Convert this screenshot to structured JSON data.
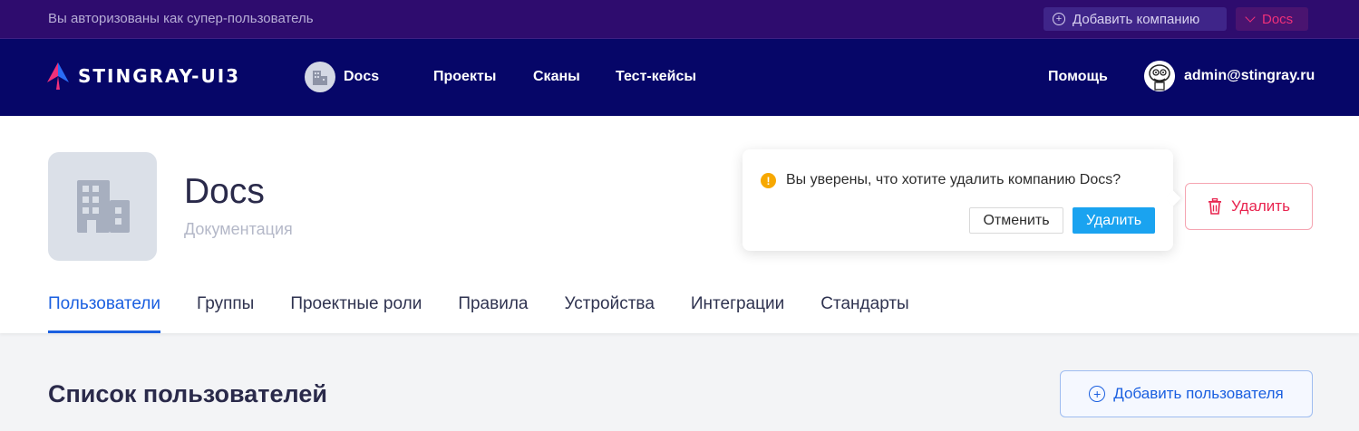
{
  "admin_bar": {
    "message": "Вы авторизованы как супер-пользователь",
    "add_company_label": "Добавить компанию",
    "company_select_label": "Docs"
  },
  "navbar": {
    "brand": "STINGRAY-UI3",
    "company_name": "Docs",
    "links": [
      {
        "label": "Проекты"
      },
      {
        "label": "Сканы"
      },
      {
        "label": "Тест-кейсы"
      }
    ],
    "help_label": "Помощь",
    "user_email": "admin@stingray.ru"
  },
  "company": {
    "name": "Docs",
    "description": "Документация",
    "delete_label": "Удалить"
  },
  "tabs": [
    {
      "label": "Пользователи",
      "active": true
    },
    {
      "label": "Группы",
      "active": false
    },
    {
      "label": "Проектные роли",
      "active": false
    },
    {
      "label": "Правила",
      "active": false
    },
    {
      "label": "Устройства",
      "active": false
    },
    {
      "label": "Интеграции",
      "active": false
    },
    {
      "label": "Стандарты",
      "active": false
    }
  ],
  "popconfirm": {
    "icon": "!",
    "message": "Вы уверены, что хотите удалить компанию Docs?",
    "cancel_label": "Отменить",
    "ok_label": "Удалить"
  },
  "users_section": {
    "title": "Список пользователей",
    "add_user_label": "Добавить пользователя"
  },
  "colors": {
    "admin_bar_bg": "#2e0c6e",
    "navbar_bg": "#060668",
    "accent_blue": "#1a5fe0",
    "danger": "#e8244f",
    "primary_button": "#1aa3f0",
    "warning": "#f7a800"
  }
}
